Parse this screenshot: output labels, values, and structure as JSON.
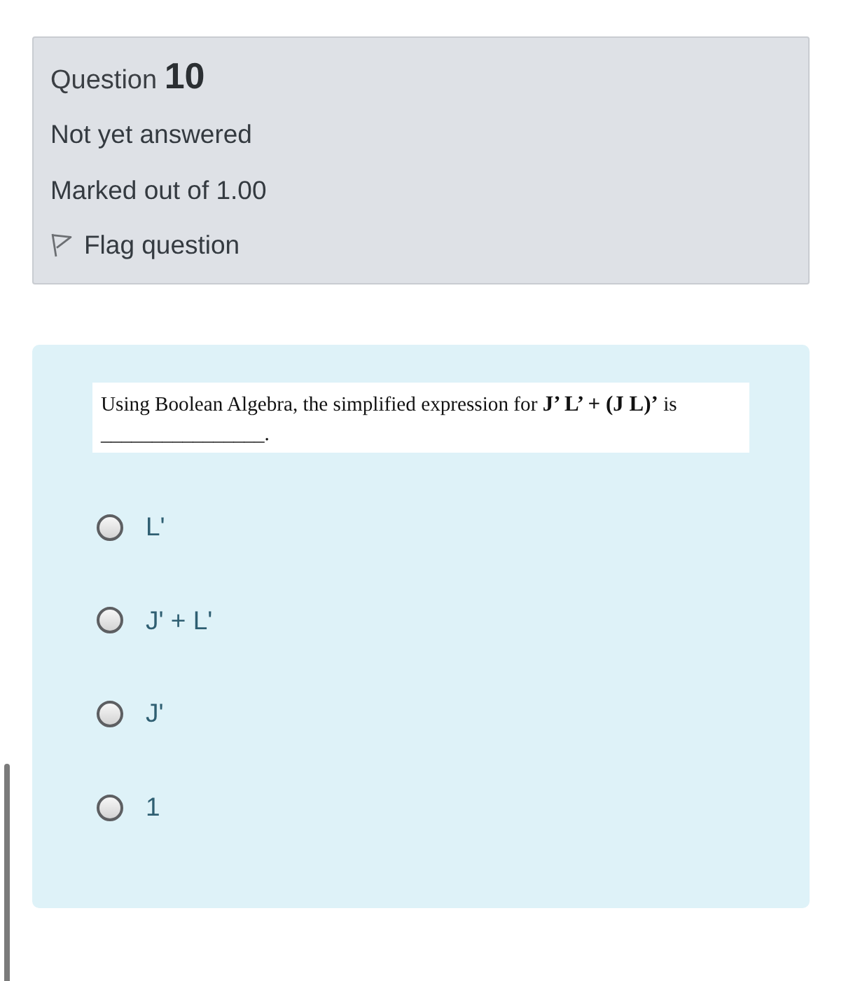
{
  "question_info": {
    "label": "Question",
    "number": "10",
    "status": "Not yet answered",
    "marks": "Marked out of 1.00",
    "flag": {
      "label": "Flag question",
      "flagged": false
    }
  },
  "question": {
    "prompt": "Using Boolean Algebra, the simplified expression for **J’ L’ + (J L)’** is",
    "blank": "________________."
  },
  "options": [
    {
      "label": "L'",
      "selected": false
    },
    {
      "label": "J' + L'",
      "selected": false
    },
    {
      "label": "J'",
      "selected": false
    },
    {
      "label": "1",
      "selected": false
    }
  ]
}
